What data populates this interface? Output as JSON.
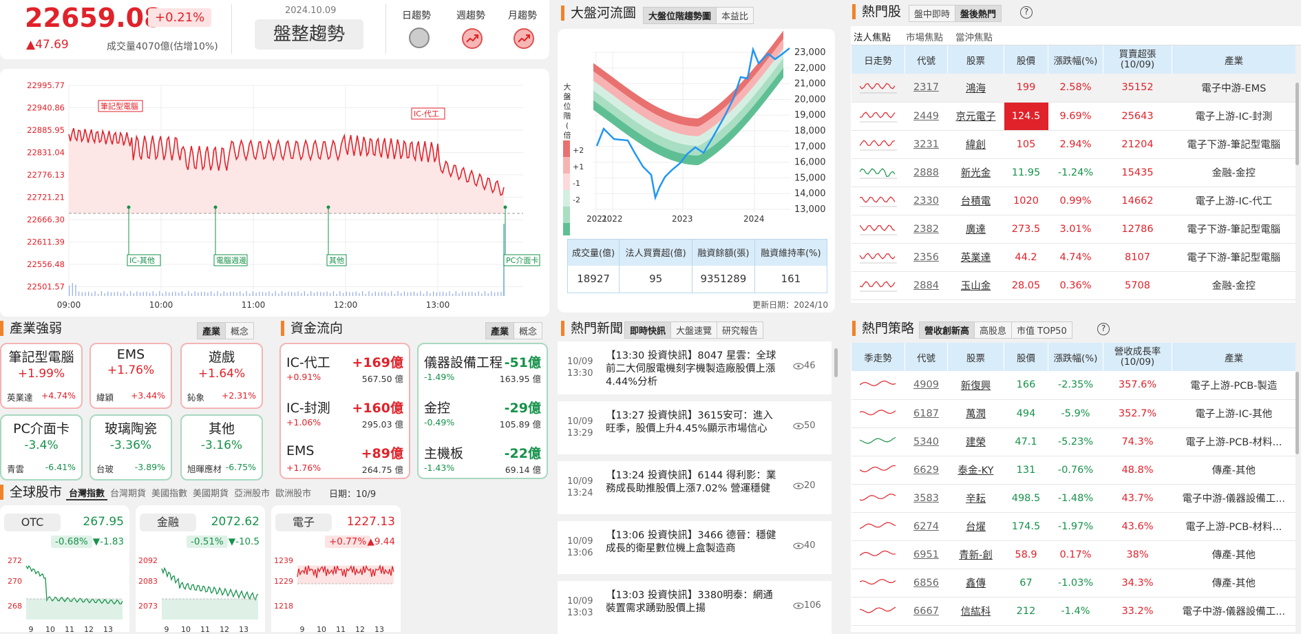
{
  "index": {
    "value": "22659.08",
    "pct": "+0.21%",
    "change": "▲47.69",
    "volume": "成交量4070億(估增10%)",
    "date": "2024.10.09",
    "trend": "盤整趨勢",
    "trend_labels": [
      "日趨勢",
      "週趨勢",
      "月趨勢"
    ]
  },
  "intraday": {
    "y_ticks": [
      "22995.77",
      "22940.86",
      "22885.95",
      "22831.04",
      "22776.13",
      "22721.21",
      "22666.30",
      "22611.39",
      "22556.48",
      "22501.57"
    ],
    "x_ticks": [
      "09:00",
      "10:00",
      "11:00",
      "12:00",
      "13:00"
    ],
    "tags_top": [
      "筆記型電腦",
      "IC-代工"
    ],
    "tags_bottom": [
      "IC-其他",
      "電腦週邊",
      "其他",
      "PC介面卡"
    ]
  },
  "river": {
    "title": "大盤河流圖",
    "tabs": [
      "大盤位階趨勢圖",
      "本益比"
    ],
    "y_ticks": [
      "23,000",
      "22,000",
      "21,000",
      "20,000",
      "19,000",
      "18,000",
      "17,000",
      "16,000",
      "15,000",
      "14,000",
      "13,000"
    ],
    "x_ticks": [
      "2021",
      "2022",
      "2023",
      "2024"
    ],
    "side_label": "大盤位階(倍)",
    "legend_ticks": [
      "+2",
      "+1",
      "-1",
      "-2"
    ],
    "table_headers": [
      "成交量(億)",
      "法人買賣超(億)",
      "融資餘額(張)",
      "融資維持率(%)"
    ],
    "table_values": [
      "18927",
      "95",
      "9351289",
      "161"
    ],
    "update": "更新日期：2024/10"
  },
  "hot": {
    "title": "熱門股",
    "tabs": [
      "盤中即時",
      "盤後熱門"
    ],
    "subtabs": [
      "法人焦點",
      "市場焦點",
      "當沖焦點"
    ],
    "headers": [
      "日走勢",
      "代號",
      "股票",
      "股價",
      "漲跌幅(%)",
      "買賣超張\n(10/09)",
      "產業"
    ],
    "rows": [
      {
        "code": "2317",
        "name": "鴻海",
        "price": "199",
        "pct": "2.58%",
        "vol": "35152",
        "ind": "電子中游-EMS"
      },
      {
        "code": "2449",
        "name": "京元電子",
        "price": "124.5",
        "pct": "9.69%",
        "vol": "25643",
        "ind": "電子上游-IC-封測"
      },
      {
        "code": "3231",
        "name": "緯創",
        "price": "105",
        "pct": "2.94%",
        "vol": "21204",
        "ind": "電子下游-筆記型電腦"
      },
      {
        "code": "2888",
        "name": "新光金",
        "price": "11.95",
        "pct": "-1.24%",
        "vol": "15435",
        "ind": "金融-金控"
      },
      {
        "code": "2330",
        "name": "台積電",
        "price": "1020",
        "pct": "0.99%",
        "vol": "14662",
        "ind": "電子上游-IC-代工"
      },
      {
        "code": "2382",
        "name": "廣達",
        "price": "273.5",
        "pct": "3.01%",
        "vol": "12786",
        "ind": "電子下游-筆記型電腦"
      },
      {
        "code": "2356",
        "name": "英業達",
        "price": "44.2",
        "pct": "4.74%",
        "vol": "8107",
        "ind": "電子下游-筆記型電腦"
      },
      {
        "code": "2884",
        "name": "玉山金",
        "price": "28.05",
        "pct": "0.36%",
        "vol": "5708",
        "ind": "金融-金控"
      }
    ]
  },
  "industry": {
    "title": "產業強弱",
    "tabs": [
      "產業",
      "概念"
    ],
    "boxes": [
      {
        "name": "筆記型電腦",
        "pct": "+1.99%",
        "s1": "英業達",
        "s2": "+4.74%"
      },
      {
        "name": "EMS",
        "pct": "+1.76%",
        "s1": "緯穎",
        "s2": "+3.44%"
      },
      {
        "name": "遊戲",
        "pct": "+1.64%",
        "s1": "鈊象",
        "s2": "+2.31%"
      },
      {
        "name": "PC介面卡",
        "pct": "-3.4%",
        "s1": "青雲",
        "s2": "-6.41%"
      },
      {
        "name": "玻璃陶瓷",
        "pct": "-3.36%",
        "s1": "台玻",
        "s2": "-3.89%"
      },
      {
        "name": "其他",
        "pct": "-3.16%",
        "s1": "旭暉應材",
        "s2": "-6.75%"
      }
    ]
  },
  "flow": {
    "title": "資金流向",
    "tabs": [
      "產業",
      "概念"
    ],
    "left": [
      {
        "n": "IC-代工",
        "v": "+169億",
        "pc": "+0.91%",
        "am": "567.50 億"
      },
      {
        "n": "IC-封測",
        "v": "+160億",
        "pc": "+1.06%",
        "am": "295.03 億"
      },
      {
        "n": "EMS",
        "v": "+89億",
        "pc": "+1.76%",
        "am": "264.75 億"
      }
    ],
    "right": [
      {
        "n": "儀器設備工程",
        "v": "-51億",
        "pc": "-1.49%",
        "am": "163.95 億"
      },
      {
        "n": "金控",
        "v": "-29億",
        "pc": "-0.49%",
        "am": "105.89 億"
      },
      {
        "n": "主機板",
        "v": "-22億",
        "pc": "-1.43%",
        "am": "69.14 億"
      }
    ]
  },
  "global": {
    "title": "全球股市",
    "tabs": [
      "台灣指數",
      "台灣期貨",
      "美國指數",
      "美國期貨",
      "亞洲股市",
      "歐洲股市"
    ],
    "date": "日期：10/9",
    "cards": [
      {
        "name": "OTC",
        "val": "267.95",
        "pct": "-0.68%",
        "chg": "▼-1.83",
        "y": [
          "272",
          "270",
          "268"
        ],
        "x": [
          "9",
          "10",
          "11",
          "12",
          "13"
        ]
      },
      {
        "name": "金融",
        "val": "2072.62",
        "pct": "-0.51%",
        "chg": "▼-10.5",
        "y": [
          "2092",
          "2083",
          "2073"
        ],
        "x": [
          "9",
          "10",
          "11",
          "12",
          "13"
        ]
      },
      {
        "name": "電子",
        "val": "1227.13",
        "pct": "+0.77%",
        "chg": "▲9.44",
        "y": [
          "1239",
          "1229",
          "1218"
        ],
        "x": [
          "9",
          "10",
          "11",
          "12",
          "13"
        ]
      }
    ]
  },
  "news": {
    "title": "熱門新聞",
    "tabs": [
      "即時快訊",
      "大盤速覽",
      "研究報告"
    ],
    "items": [
      {
        "d1": "10/09",
        "d2": "13:30",
        "t": "【13:30 投資快訊】8047 星雲：全球前二大伺服電機刻字機製造廠股價上漲4.44%分析",
        "eye": "46"
      },
      {
        "d1": "10/09",
        "d2": "13:29",
        "t": "【13:27 投資快訊】3615安可：進入旺季，股價上升4.45%顯示市場信心",
        "eye": "50"
      },
      {
        "d1": "10/09",
        "d2": "13:24",
        "t": "【13:24 投資快訊】6144 得利影：業務成長助推股價上漲7.02% 營運穩健",
        "eye": "20"
      },
      {
        "d1": "10/09",
        "d2": "13:06",
        "t": "【13:06 投資快訊】3466 德晉：穩健成長的衛星數位機上盒製造商",
        "eye": "40"
      },
      {
        "d1": "10/09",
        "d2": "13:03",
        "t": "【13:03 投資快訊】3380明泰：網通裝置需求踴勁股價上揚",
        "eye": "106"
      }
    ]
  },
  "strategy": {
    "title": "熱門策略",
    "tabs": [
      "營收創新高",
      "高股息",
      "市值 TOP50"
    ],
    "headers": [
      "季走勢",
      "代號",
      "股票",
      "股價",
      "漲跌幅(%)",
      "營收成長率\n(10/09)",
      "產業"
    ],
    "rows": [
      {
        "code": "4909",
        "name": "新復興",
        "price": "166",
        "pct": "-2.35%",
        "gr": "357.6%",
        "ind": "電子上游-PCB-製造"
      },
      {
        "code": "6187",
        "name": "萬潤",
        "price": "494",
        "pct": "-5.9%",
        "gr": "352.7%",
        "ind": "電子上游-IC-其他"
      },
      {
        "code": "5340",
        "name": "建榮",
        "price": "47.1",
        "pct": "-5.23%",
        "gr": "74.3%",
        "ind": "電子上游-PCB-材料..."
      },
      {
        "code": "6629",
        "name": "泰金-KY",
        "price": "131",
        "pct": "-0.76%",
        "gr": "48.8%",
        "ind": "傳產-其他"
      },
      {
        "code": "3583",
        "name": "辛耘",
        "price": "498.5",
        "pct": "-1.48%",
        "gr": "43.7%",
        "ind": "電子中游-儀器設備工..."
      },
      {
        "code": "6274",
        "name": "台燿",
        "price": "174.5",
        "pct": "-1.97%",
        "gr": "43.6%",
        "ind": "電子上游-PCB-材料..."
      },
      {
        "code": "6951",
        "name": "青新-創",
        "price": "58.9",
        "pct": "0.17%",
        "gr": "38%",
        "ind": "傳產-其他"
      },
      {
        "code": "6856",
        "name": "鑫傳",
        "price": "67",
        "pct": "-1.03%",
        "gr": "34.3%",
        "ind": "傳產-其他"
      },
      {
        "code": "6667",
        "name": "信紘科",
        "price": "212",
        "pct": "-1.4%",
        "gr": "33.2%",
        "ind": "電子中游-儀器設備工..."
      }
    ]
  }
}
